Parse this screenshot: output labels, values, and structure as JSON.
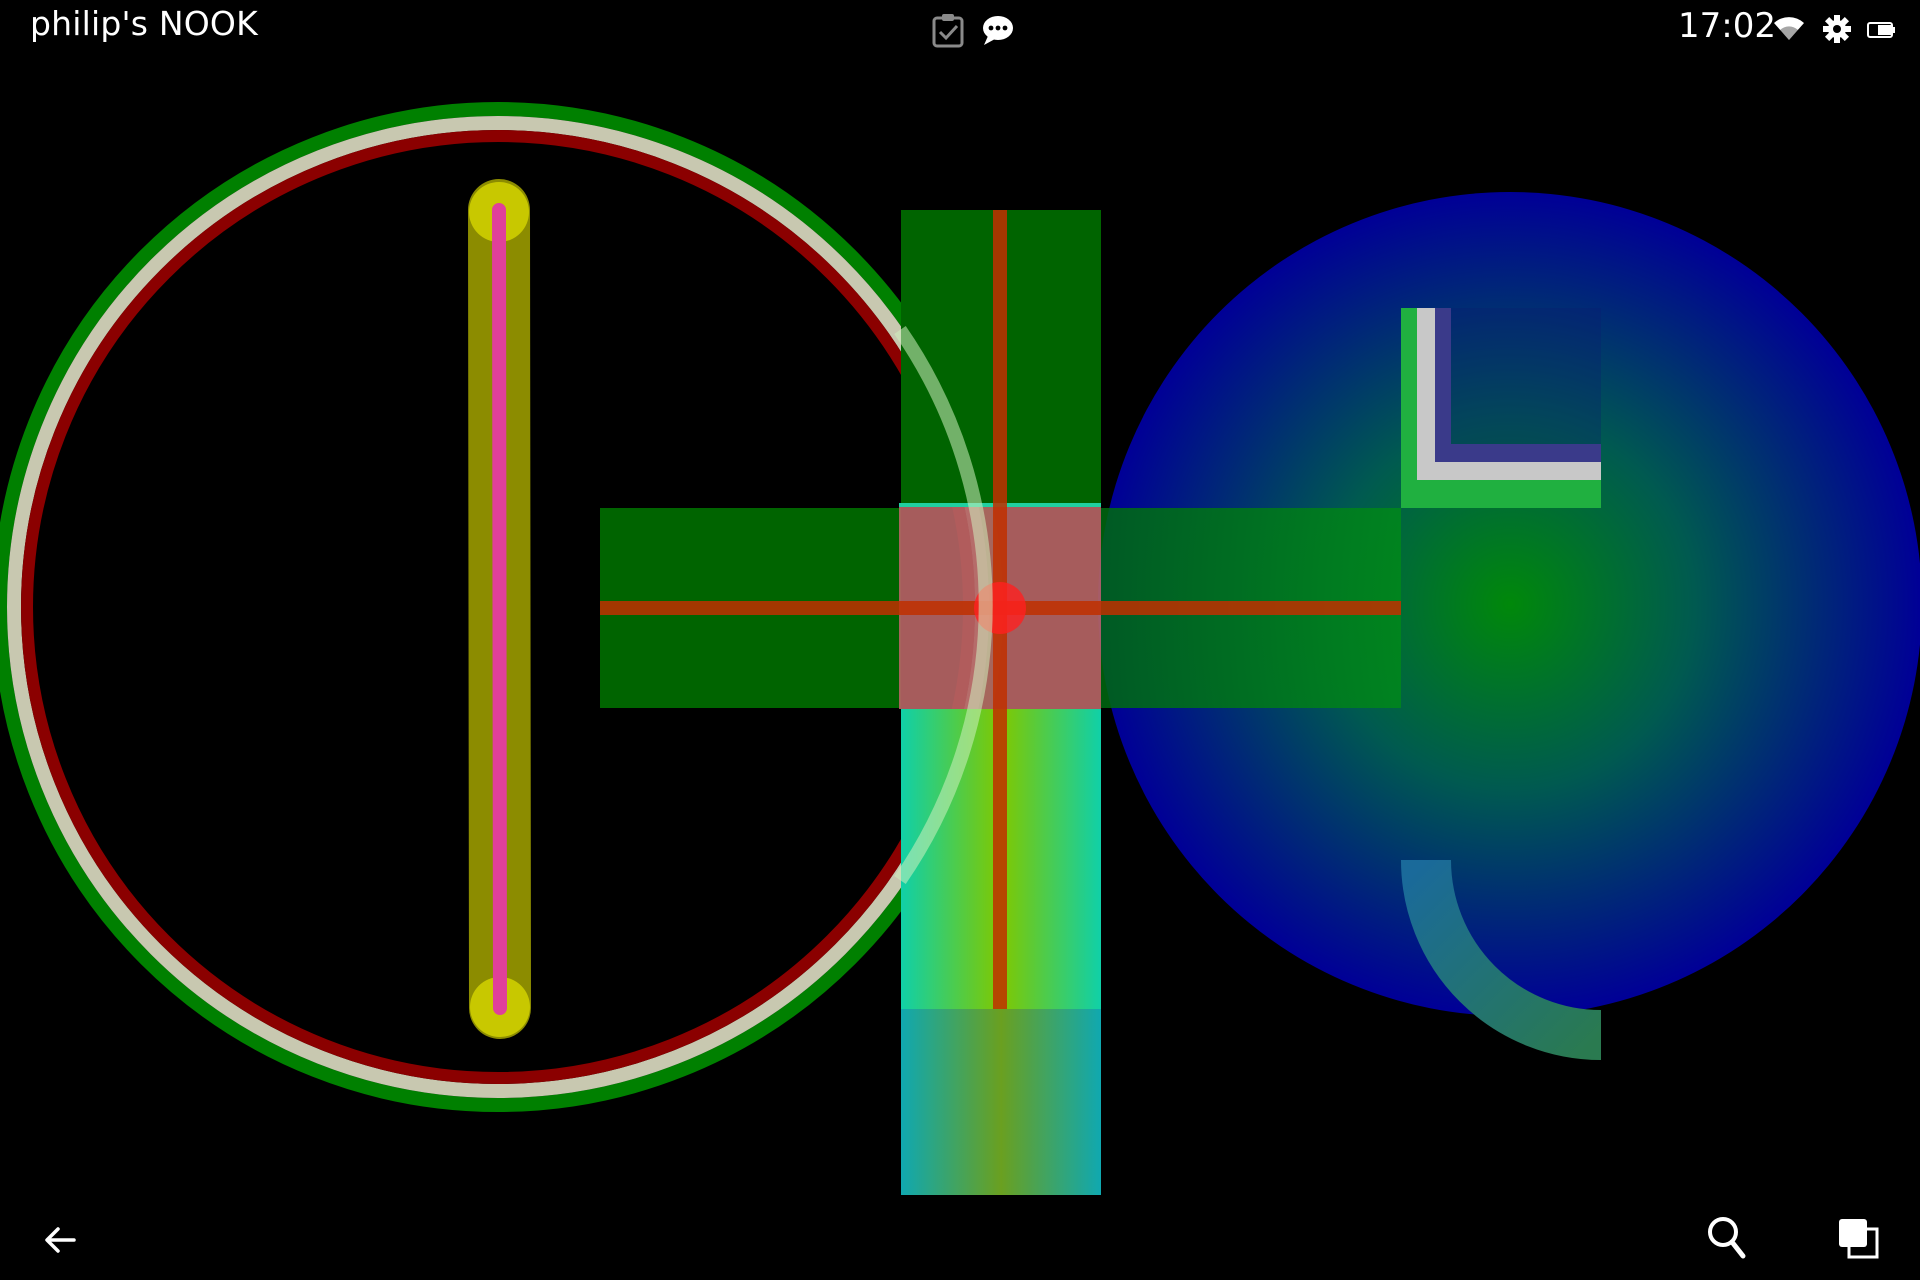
{
  "status_bar": {
    "device_name": "philip's NOOK",
    "time": "17:02",
    "icons": [
      "clipboard-check-icon",
      "chat-bubble-icon",
      "wifi-icon",
      "settings-gear-icon",
      "battery-icon"
    ]
  },
  "nav_bar": {
    "icons": [
      "back-arrow-icon",
      "search-icon",
      "recent-apps-icon"
    ]
  },
  "colors": {
    "background": "#000000",
    "circle_outer_green": "#008000",
    "circle_mid_white": "#c8c8b4",
    "circle_inner_red": "#8b0000",
    "vertical_bar_yellow": "#8c8c00",
    "vertical_line_pink": "#e0409a",
    "cross_green": "#006400",
    "cross_center_pink": "#c86464",
    "cross_line_red": "#c00000",
    "cross_bottom_teal": "#10c8a0",
    "sphere_blue": "#000090",
    "sphere_center_green": "#00880a"
  }
}
